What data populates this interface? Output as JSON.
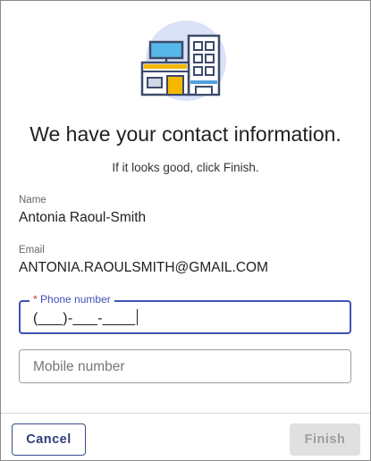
{
  "dialog": {
    "headline": "We have your contact information.",
    "subtext": "If it looks good, click Finish."
  },
  "illustration": {
    "icon": "office-buildings-icon"
  },
  "fields": {
    "name_label": "Name",
    "name_value": "Antonia Raoul-Smith",
    "email_label": "Email",
    "email_value": "ANTONIA.RAOULSMITH@GMAIL.COM"
  },
  "phone": {
    "required_mark": "*",
    "label": "Phone number",
    "value": "(___)-___-____"
  },
  "mobile": {
    "placeholder": "Mobile number"
  },
  "buttons": {
    "cancel": "Cancel",
    "finish": "Finish"
  },
  "colors": {
    "accent": "#3f51b5",
    "required": "#d32f2f",
    "disabled_bg": "#e0e0e0"
  }
}
